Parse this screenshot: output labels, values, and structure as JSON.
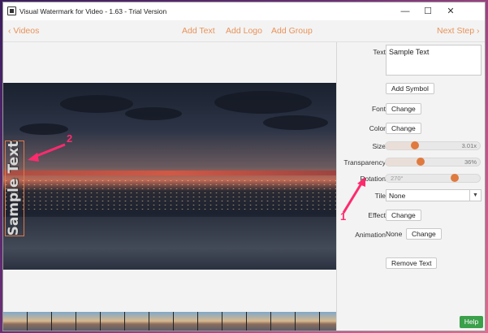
{
  "window": {
    "title": "Visual Watermark for Video - 1.63 - Trial Version",
    "controls": {
      "minimize": "—",
      "maximize": "☐",
      "close": "✕"
    }
  },
  "nav": {
    "back_label": "Videos",
    "add_text": "Add Text",
    "add_logo": "Add Logo",
    "add_group": "Add Group",
    "next_label": "Next Step"
  },
  "watermark": {
    "text": "Sample Text"
  },
  "panel": {
    "text_label": "Text",
    "text_value": "Sample Text",
    "add_symbol": "Add Symbol",
    "font_label": "Font",
    "font_button": "Change",
    "color_label": "Color",
    "color_button": "Change",
    "size_label": "Size",
    "size_value": "3.01x",
    "size_level": 0.29,
    "transparency_label": "Transparency",
    "transparency_value": "36%",
    "transparency_level": 0.36,
    "rotation_label": "Rotation",
    "rotation_value": "270°",
    "rotation_level": 0.75,
    "tile_label": "Tile",
    "tile_value": "None",
    "effect_label": "Effect",
    "effect_button": "Change",
    "animation_label": "Animation",
    "animation_value": "None",
    "animation_button": "Change",
    "remove_text": "Remove Text",
    "help": "Help"
  },
  "annotations": {
    "one": "1",
    "two": "2"
  },
  "colors": {
    "accent": "#e8935a",
    "knob": "#e07a3f",
    "help": "#3aa04a",
    "annotation": "#ff2a6d"
  }
}
